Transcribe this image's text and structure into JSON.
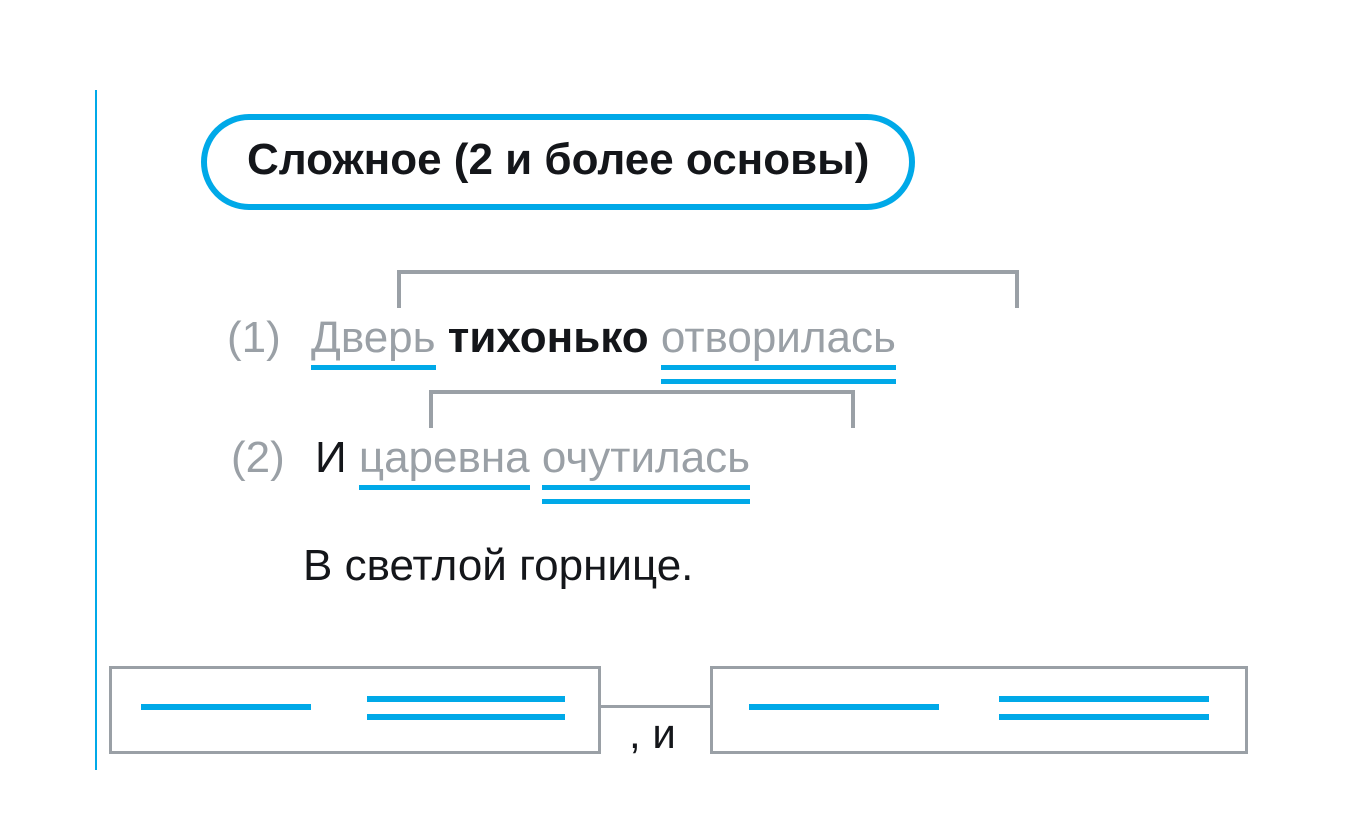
{
  "title": "Сложное (2 и более основы)",
  "lines": {
    "l1": {
      "marker": "(1)",
      "w1": "Дверь",
      "w2": "тихонько",
      "w3": "отворилась"
    },
    "l2": {
      "marker": "(2)",
      "w1": "И",
      "w2": "царевна",
      "w3": "очутилась"
    },
    "l3": {
      "text": "В светлой горнице."
    }
  },
  "schema": {
    "separator": ", и"
  },
  "colors": {
    "accent": "#00a9e8",
    "muted": "#9aa0a6"
  }
}
